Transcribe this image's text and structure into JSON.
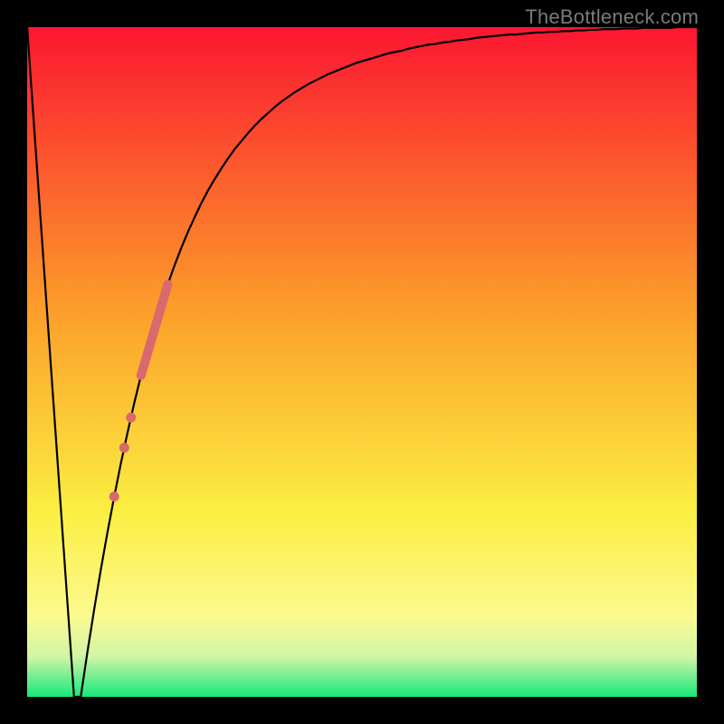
{
  "watermark": "TheBottleneck.com",
  "colors": {
    "bg_black": "#000000",
    "curve": "#000000",
    "marker": "#d8696c",
    "grad_top": "#fb1631",
    "grad_mid1": "#fc9d2a",
    "grad_mid2": "#fbee41",
    "grad_mid3": "#fbfa8f",
    "grad_mid4": "#d1f5a6",
    "grad_bottom": "#15e87b"
  },
  "chart_data": {
    "type": "line",
    "title": "",
    "xlabel": "",
    "ylabel": "",
    "x": [
      0,
      1,
      2,
      3,
      4,
      5,
      6,
      7,
      8,
      9,
      10,
      11,
      12,
      13,
      14,
      15,
      16,
      17,
      18,
      19,
      20,
      21,
      22,
      23,
      24,
      25,
      26,
      27,
      28,
      29,
      30,
      31,
      32,
      33,
      34,
      35,
      36,
      37,
      38,
      39,
      40,
      41,
      42,
      43,
      44,
      45,
      46,
      47,
      48,
      49,
      50,
      51,
      52,
      53,
      54,
      55,
      56,
      57,
      58,
      59,
      60,
      61,
      62,
      63,
      64,
      65,
      66,
      67,
      68,
      69,
      70,
      71,
      72,
      73,
      74,
      75,
      76,
      77,
      78,
      79,
      80,
      81,
      82,
      83,
      84,
      85,
      86,
      87,
      88,
      89,
      90,
      91,
      92,
      93,
      94,
      95,
      96,
      97,
      98,
      99,
      100
    ],
    "y": [
      100,
      85.7,
      71.4,
      57.1,
      42.9,
      28.6,
      14.3,
      0,
      0,
      6.7,
      13,
      19,
      24.6,
      29.9,
      34.9,
      39.5,
      43.9,
      48,
      51.8,
      55.3,
      58.6,
      61.6,
      64.4,
      67,
      69.4,
      71.6,
      73.7,
      75.6,
      77.3,
      78.9,
      80.4,
      81.8,
      83,
      84.2,
      85.3,
      86.3,
      87.2,
      88.1,
      88.9,
      89.6,
      90.3,
      90.9,
      91.5,
      92,
      92.5,
      93,
      93.4,
      93.8,
      94.2,
      94.6,
      94.9,
      95.2,
      95.5,
      95.8,
      96.1,
      96.3,
      96.5,
      96.8,
      97,
      97.2,
      97.4,
      97.5,
      97.7,
      97.8,
      98,
      98.1,
      98.2,
      98.4,
      98.5,
      98.6,
      98.7,
      98.8,
      98.9,
      98.9,
      99,
      99.1,
      99.2,
      99.2,
      99.3,
      99.3,
      99.4,
      99.4,
      99.5,
      99.5,
      99.6,
      99.6,
      99.7,
      99.7,
      99.7,
      99.8,
      99.8,
      99.8,
      99.9,
      99.9,
      99.9,
      99.9,
      99.9,
      100,
      100,
      100,
      100
    ],
    "xlim": [
      0,
      100
    ],
    "ylim": [
      0,
      100
    ],
    "markers": {
      "segment": {
        "x_start": 17,
        "x_end": 21,
        "thickness": 10
      },
      "points": [
        {
          "x": 15.5
        },
        {
          "x": 14.5
        },
        {
          "x": 13.0
        }
      ]
    }
  }
}
